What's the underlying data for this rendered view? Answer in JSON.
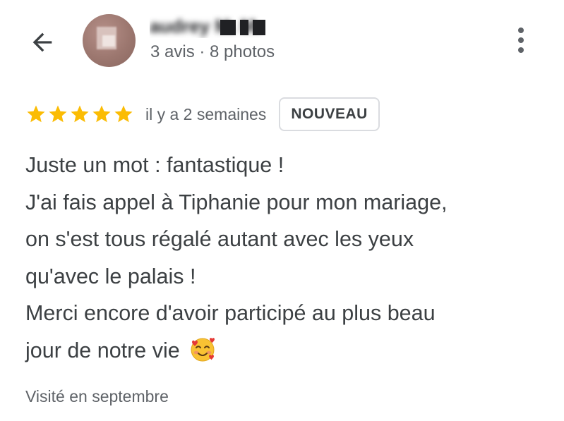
{
  "header": {
    "back_icon": "arrow-back-icon",
    "reviewer_name": "audrey M. M.",
    "reviewer_stats": "3 avis · 8 photos",
    "more_icon": "more-vert-icon"
  },
  "review": {
    "rating": 5,
    "rating_max": 5,
    "star_color": "#fbbc04",
    "date": "il y a 2 semaines",
    "badge": "NOUVEAU",
    "lines": [
      "Juste un mot : fantastique !",
      "J'ai fais appel à Tiphanie pour mon mariage,",
      "on s'est tous régalé autant avec les yeux",
      "qu'avec le palais !",
      "Merci encore d'avoir participé au plus beau",
      "jour de notre vie"
    ],
    "last_line_emoji": "smiling-face-with-hearts-icon",
    "visit": "Visité en septembre"
  }
}
